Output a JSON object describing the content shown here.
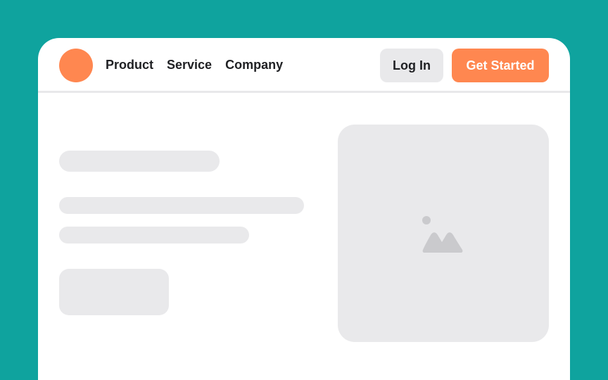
{
  "nav": {
    "items": [
      {
        "label": "Product"
      },
      {
        "label": "Service"
      },
      {
        "label": "Company"
      }
    ]
  },
  "actions": {
    "login_label": "Log In",
    "get_started_label": "Get Started"
  },
  "colors": {
    "background": "#0fa39e",
    "accent": "#ff8750",
    "placeholder": "#e9e9eb",
    "surface": "#ffffff",
    "text": "#202124"
  },
  "icons": {
    "logo": "logo-circle",
    "image_placeholder": "image-icon"
  }
}
